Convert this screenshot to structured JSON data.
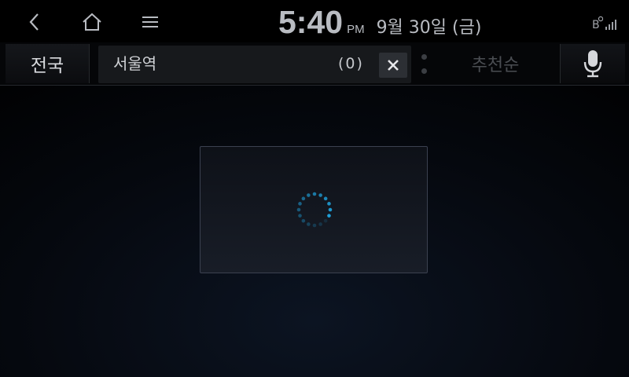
{
  "status_bar": {
    "nav": {
      "back_icon": "chevron-left-icon",
      "home_icon": "home-icon",
      "menu_icon": "hamburger-menu-icon"
    },
    "clock": {
      "time": "5:40",
      "ampm": "PM",
      "date": "9월 30일 (금)"
    },
    "indicators": {
      "bluetooth_icon": "bluetooth-phone-icon",
      "signal_icon": "signal-strength-icon"
    }
  },
  "search_bar": {
    "region_label": "전국",
    "query": "서울역",
    "result_count": "(0)",
    "clear_icon": "close-icon",
    "sort_label": "추천순",
    "mic_icon": "microphone-icon"
  },
  "loading": {
    "spinner_icon": "loading-spinner-icon"
  },
  "colors": {
    "accent": "#1f9fd8",
    "text": "#cfd1d5",
    "dim_text": "#4a4d52"
  }
}
